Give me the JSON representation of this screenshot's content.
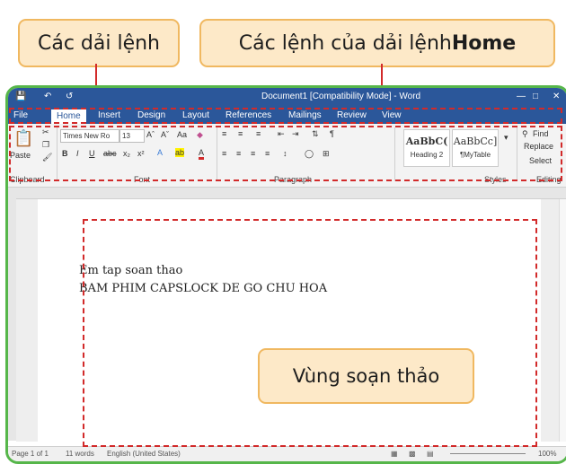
{
  "callouts": {
    "ribbon": "Các dải lệnh",
    "home_prefix": "Các lệnh của dải lệnh ",
    "home_bold": "Home",
    "editing_area": "Vùng soạn thảo"
  },
  "titlebar": {
    "title": "Document1 [Compatibility Mode] - Word"
  },
  "tabs": [
    "File",
    "Home",
    "Insert",
    "Design",
    "Layout",
    "References",
    "Mailings",
    "Review",
    "View"
  ],
  "ribbon": {
    "paste": "Paste",
    "font_name": "Times New Ro",
    "font_size": "13",
    "bold": "B",
    "italic": "I",
    "underline": "U",
    "strike": "abc",
    "style1_preview": "AaBbC(",
    "style1_name": "Heading 2",
    "style2_preview": "AaBbCc]",
    "style2_name": "¶MyTable",
    "find": "Find",
    "replace": "Replace",
    "select": "Select",
    "groups": {
      "clipboard": "Clipboard",
      "font": "Font",
      "paragraph": "Paragraph",
      "styles": "Styles",
      "editing": "Editing"
    }
  },
  "document": {
    "line1": "Em tap soan thao",
    "line2": "BAM PHIM CAPSLOCK DE GO CHU HOA"
  },
  "statusbar": {
    "page": "Page 1 of 1",
    "words": "11 words",
    "language": "English (United States)",
    "zoom": "100%"
  },
  "colors": {
    "accent": "#2b579a",
    "callout_fill": "#fde9c8",
    "callout_border": "#f0b860",
    "highlight": "#d22a2a",
    "frame": "#56b64a"
  }
}
